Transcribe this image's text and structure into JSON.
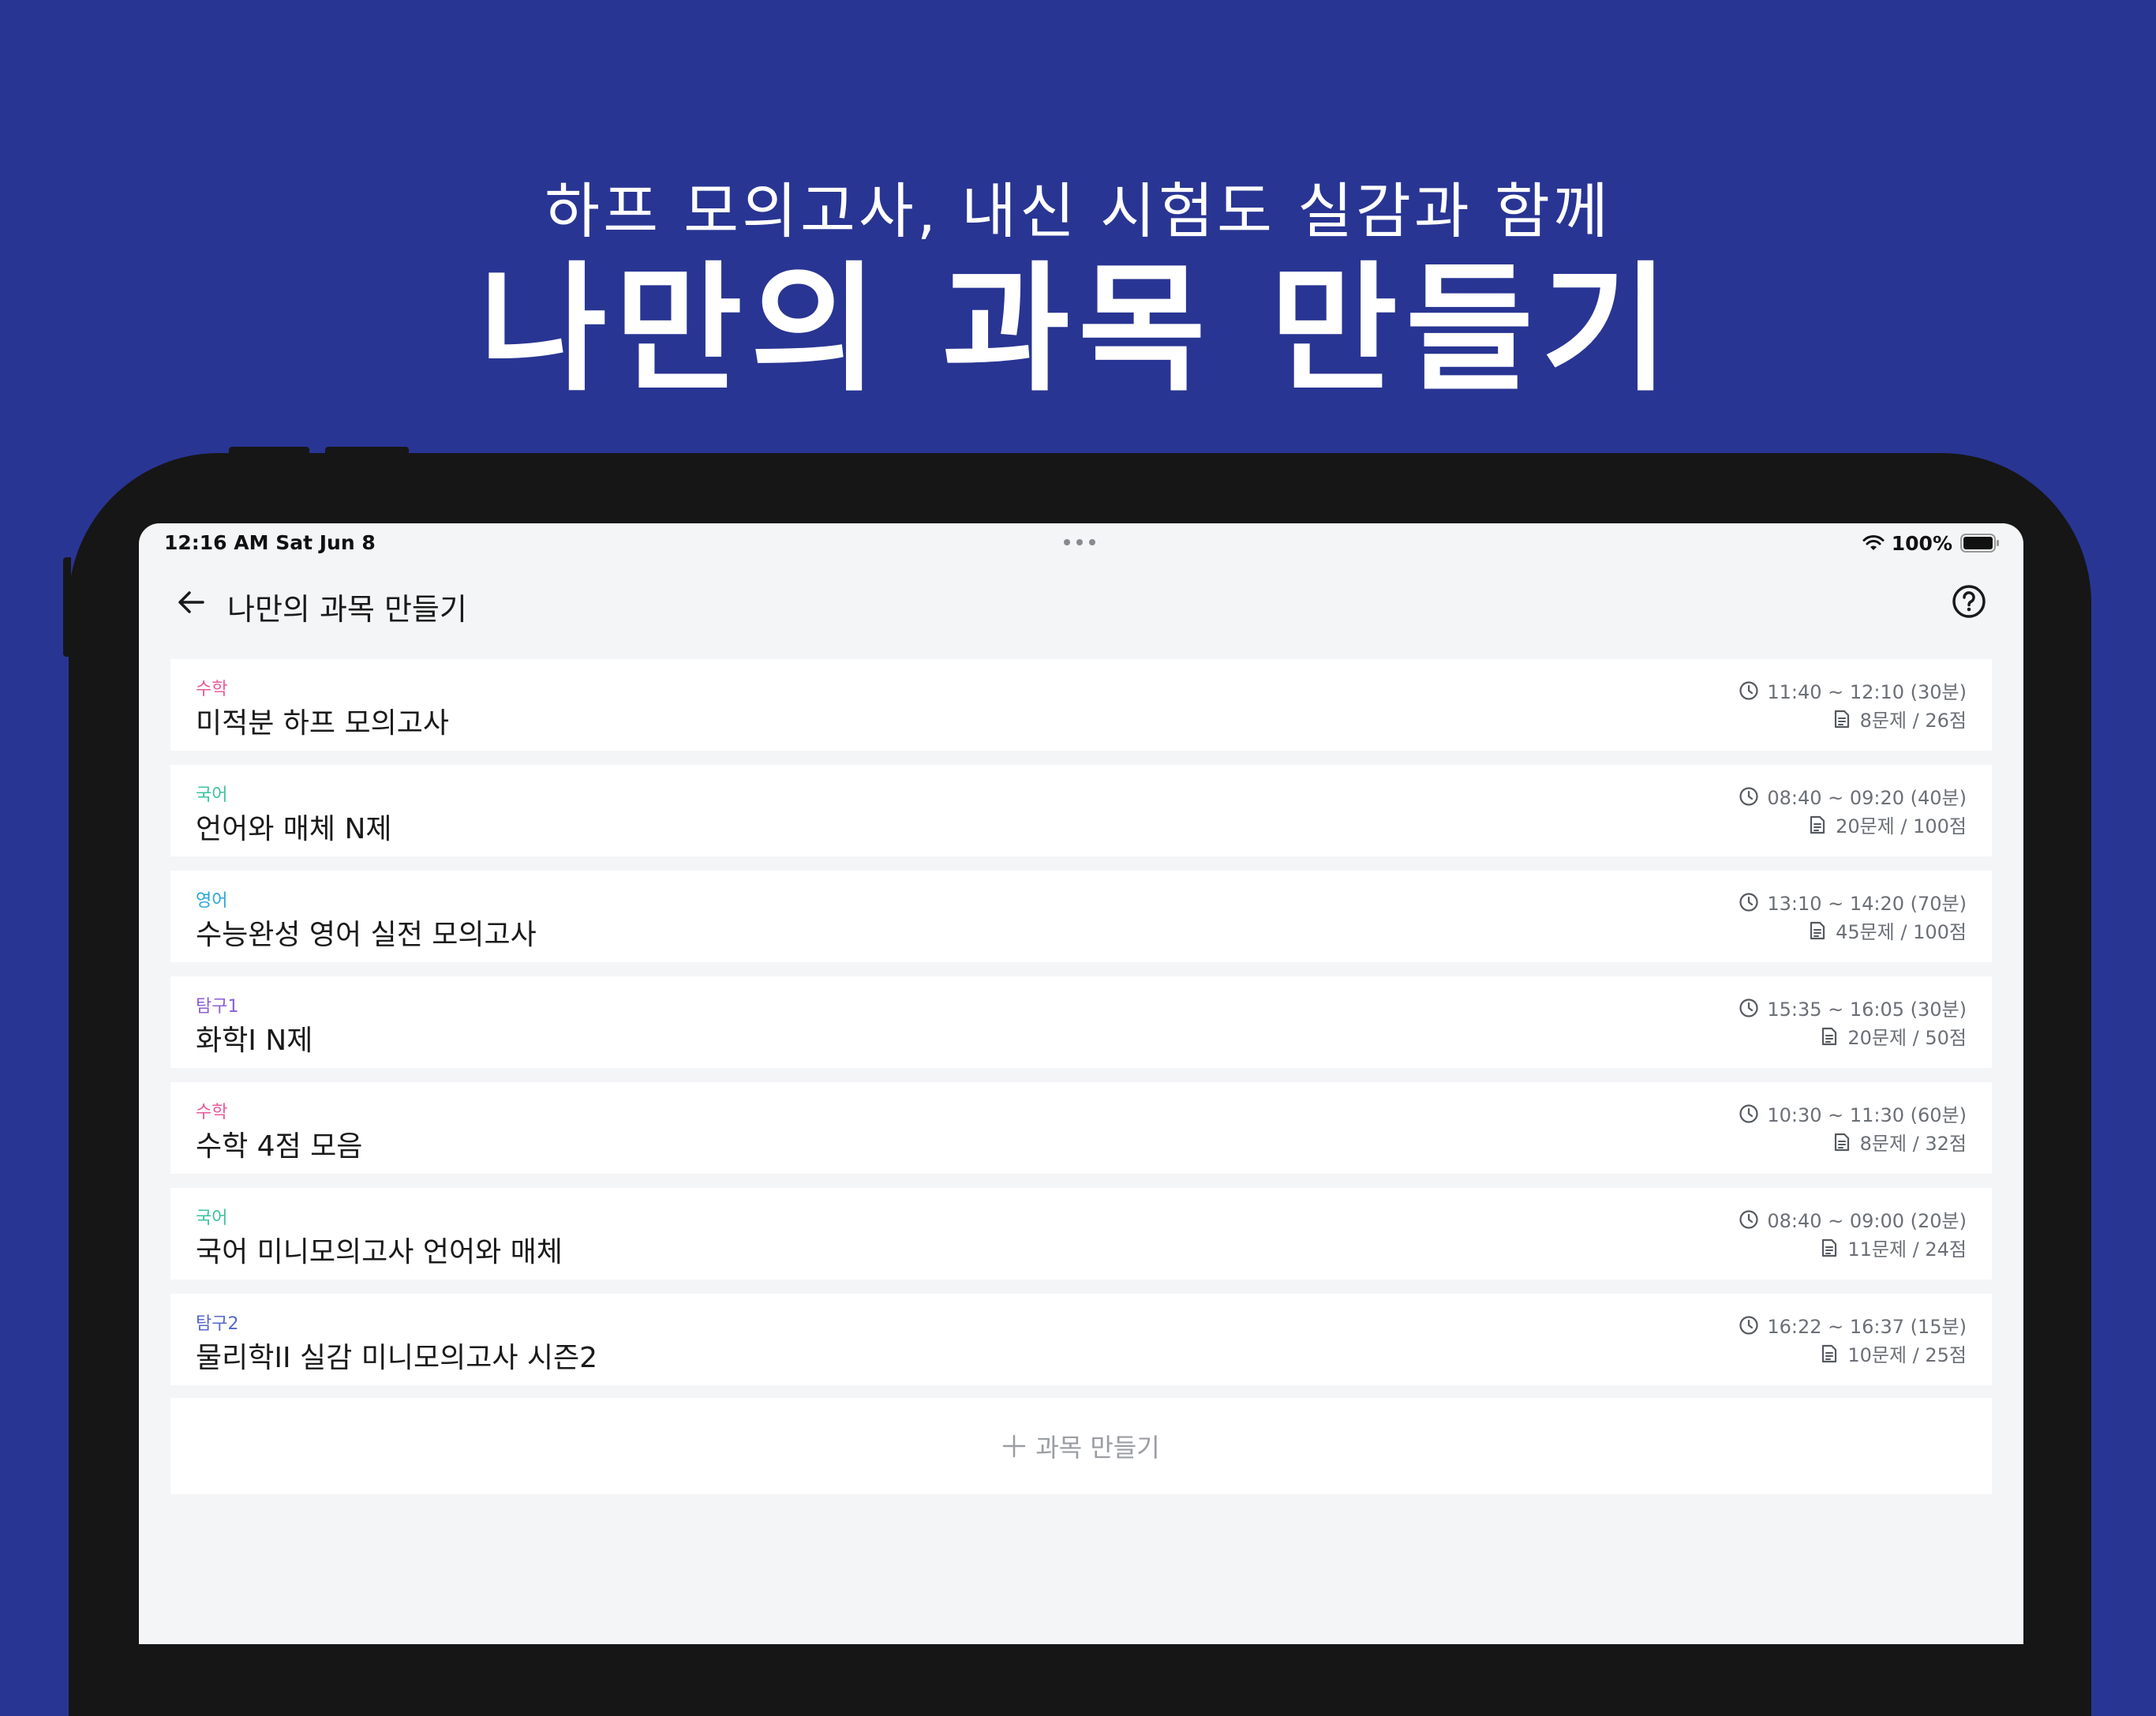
{
  "promo": {
    "subtitle": "하프 모의고사, 내신 시험도 실감과 함께",
    "title": "나만의 과목 만들기"
  },
  "status_bar": {
    "time": "12:16 AM   Sat Jun 8",
    "battery": "100%"
  },
  "nav": {
    "title": "나만의 과목 만들기"
  },
  "subjects": [
    {
      "category": "수학",
      "category_color": "#e95a9b",
      "name": "미적분 하프 모의고사",
      "time": "11:40 ~ 12:10 (30분)",
      "questions": "8문제 / 26점"
    },
    {
      "category": "국어",
      "category_color": "#3cc39e",
      "name": "언어와 매체 N제",
      "time": "08:40 ~ 09:20 (40분)",
      "questions": "20문제 / 100점"
    },
    {
      "category": "영어",
      "category_color": "#2aa6d8",
      "name": "수능완성 영어 실전 모의고사",
      "time": "13:10 ~ 14:20 (70분)",
      "questions": "45문제 / 100점"
    },
    {
      "category": "탐구1",
      "category_color": "#8a5fd6",
      "name": "화학I N제",
      "time": "15:35 ~ 16:05 (30분)",
      "questions": "20문제 / 50점"
    },
    {
      "category": "수학",
      "category_color": "#e95a9b",
      "name": "수학 4점 모음",
      "time": "10:30 ~ 11:30 (60분)",
      "questions": "8문제 / 32점"
    },
    {
      "category": "국어",
      "category_color": "#3cc39e",
      "name": "국어 미니모의고사 언어와 매체",
      "time": "08:40 ~ 09:00 (20분)",
      "questions": "11문제 / 24점"
    },
    {
      "category": "탐구2",
      "category_color": "#5468c9",
      "name": "물리학II 실감 미니모의고사 시즌2",
      "time": "16:22 ~ 16:37 (15분)",
      "questions": "10문제 / 25점"
    }
  ],
  "add_button": {
    "label": "과목 만들기"
  }
}
